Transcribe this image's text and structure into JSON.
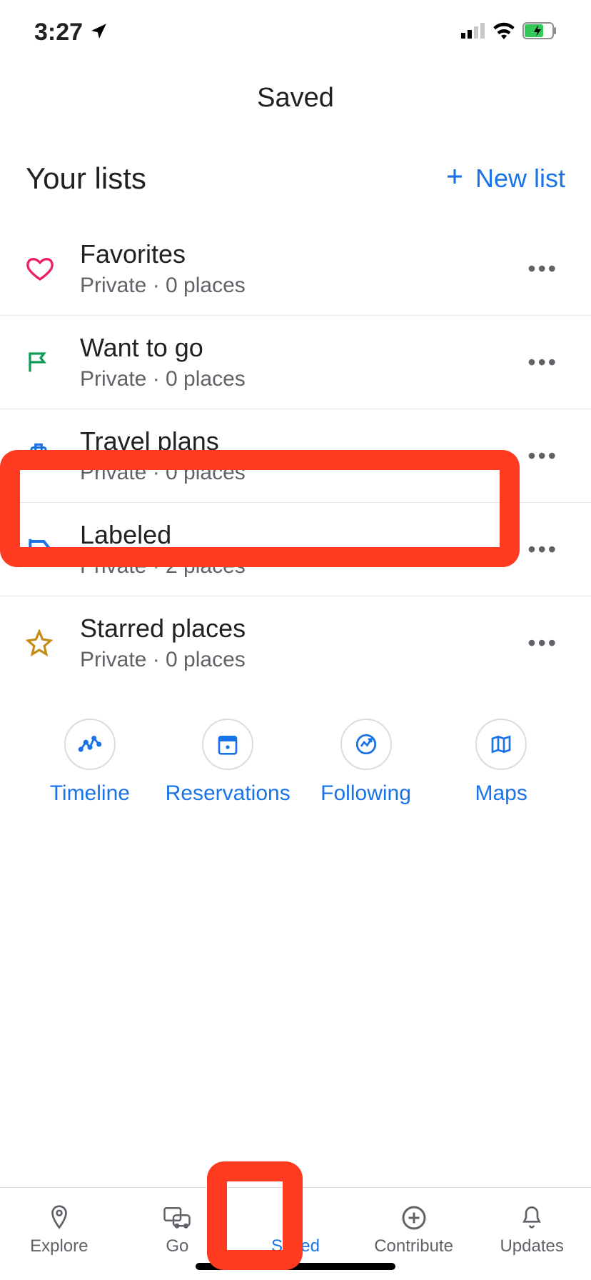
{
  "status": {
    "time": "3:27"
  },
  "header": {
    "title": "Saved"
  },
  "section": {
    "title": "Your lists",
    "new_list_label": "New list"
  },
  "lists": [
    {
      "title": "Favorites",
      "subtitle": "Private · 0 places"
    },
    {
      "title": "Want to go",
      "subtitle": "Private · 0 places"
    },
    {
      "title": "Travel plans",
      "subtitle": "Private · 0 places"
    },
    {
      "title": "Labeled",
      "subtitle": "Private · 2 places"
    },
    {
      "title": "Starred places",
      "subtitle": "Private · 0 places"
    }
  ],
  "quick_actions": [
    {
      "label": "Timeline"
    },
    {
      "label": "Reservations"
    },
    {
      "label": "Following"
    },
    {
      "label": "Maps"
    }
  ],
  "tabs": [
    {
      "label": "Explore"
    },
    {
      "label": "Go"
    },
    {
      "label": "Saved"
    },
    {
      "label": "Contribute"
    },
    {
      "label": "Updates"
    }
  ]
}
